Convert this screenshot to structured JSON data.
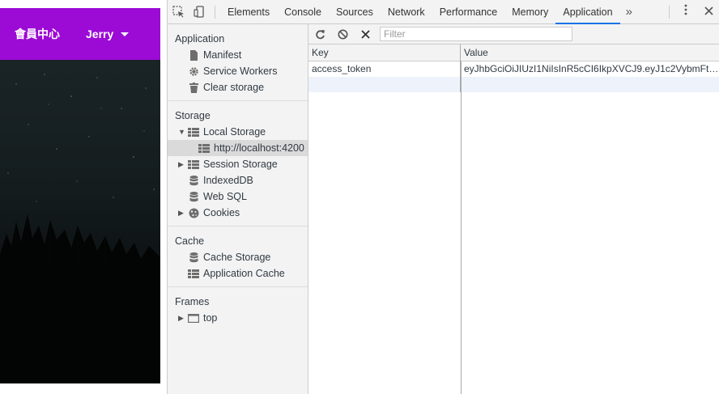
{
  "page": {
    "member_center": "會員中心",
    "user_name": "Jerry",
    "header_color": "#9c0ad6"
  },
  "devtools": {
    "tabs": [
      {
        "label": "Elements"
      },
      {
        "label": "Console"
      },
      {
        "label": "Sources"
      },
      {
        "label": "Network"
      },
      {
        "label": "Performance"
      },
      {
        "label": "Memory"
      },
      {
        "label": "Application",
        "active": true
      }
    ],
    "more_tabs": "»",
    "sidebar": {
      "application": {
        "title": "Application",
        "items": [
          "Manifest",
          "Service Workers",
          "Clear storage"
        ]
      },
      "storage": {
        "title": "Storage",
        "local_storage": "Local Storage",
        "local_origin": "http://localhost:4200",
        "session_storage": "Session Storage",
        "indexeddb": "IndexedDB",
        "websql": "Web SQL",
        "cookies": "Cookies"
      },
      "cache": {
        "title": "Cache",
        "items": [
          "Cache Storage",
          "Application Cache"
        ]
      },
      "frames": {
        "title": "Frames",
        "top": "top"
      }
    },
    "storage_view": {
      "filter_placeholder": "Filter",
      "columns": {
        "key": "Key",
        "value": "Value"
      },
      "rows": [
        {
          "key": "access_token",
          "value": "eyJhbGciOiJIUzI1NiIsInR5cCI6IkpXVCJ9.eyJ1c2VybmFtZ..."
        }
      ]
    }
  }
}
